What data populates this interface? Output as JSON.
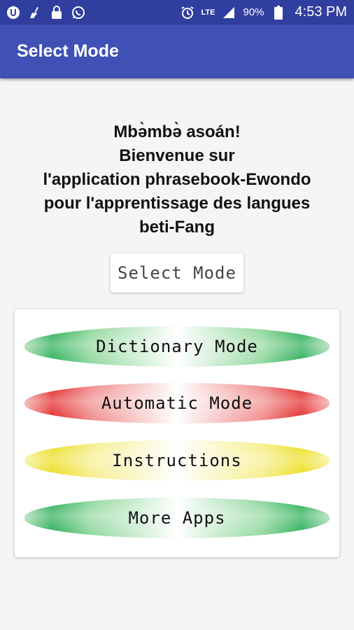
{
  "status_bar": {
    "battery": "90%",
    "network": "LTE",
    "time": "4:53 PM",
    "left_icons": [
      "u-app-icon",
      "broom-icon",
      "lock-icon",
      "whatsapp-icon"
    ],
    "right_icons": [
      "alarm-icon",
      "lte-icon",
      "signal-icon",
      "battery-icon"
    ]
  },
  "app_bar": {
    "title": "Select Mode"
  },
  "welcome": {
    "lines": [
      "Mbə̀mbə̀ asoán!",
      "Bienvenue sur",
      "l'application phrasebook-Ewondo",
      "pour l'apprentissage des langues",
      "beti-Fang"
    ]
  },
  "select_mode_button": {
    "label": "Select Mode"
  },
  "modes": [
    {
      "label": "Dictionary Mode",
      "color": "green"
    },
    {
      "label": "Automatic Mode",
      "color": "red"
    },
    {
      "label": "Instructions",
      "color": "yellow"
    },
    {
      "label": "More Apps",
      "color": "green"
    }
  ],
  "colors": {
    "status_bar": "#303f9f",
    "app_bar": "#3f51b5",
    "background": "#f5f5f5"
  }
}
